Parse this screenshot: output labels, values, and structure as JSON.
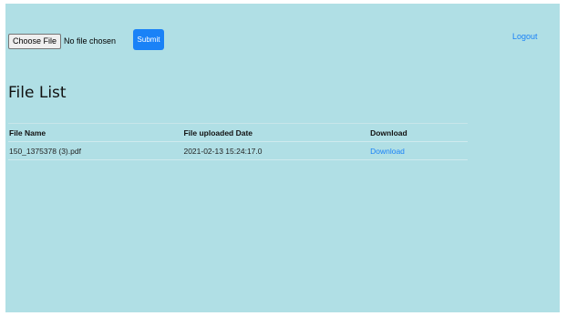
{
  "upload": {
    "choose_label": "Choose File",
    "status": "No file chosen",
    "submit_label": "Submit"
  },
  "header": {
    "logout_label": "Logout"
  },
  "main": {
    "title": "File List",
    "table": {
      "columns": [
        "File Name",
        "File uploaded Date",
        "Download"
      ],
      "rows": [
        {
          "file_name": "150_1375378 (3).pdf",
          "uploaded": "2021-02-13 15:24:17.0",
          "download_label": "Download"
        }
      ]
    }
  },
  "colors": {
    "page_background": "#b0dfe5",
    "accent": "#1a82f7"
  }
}
